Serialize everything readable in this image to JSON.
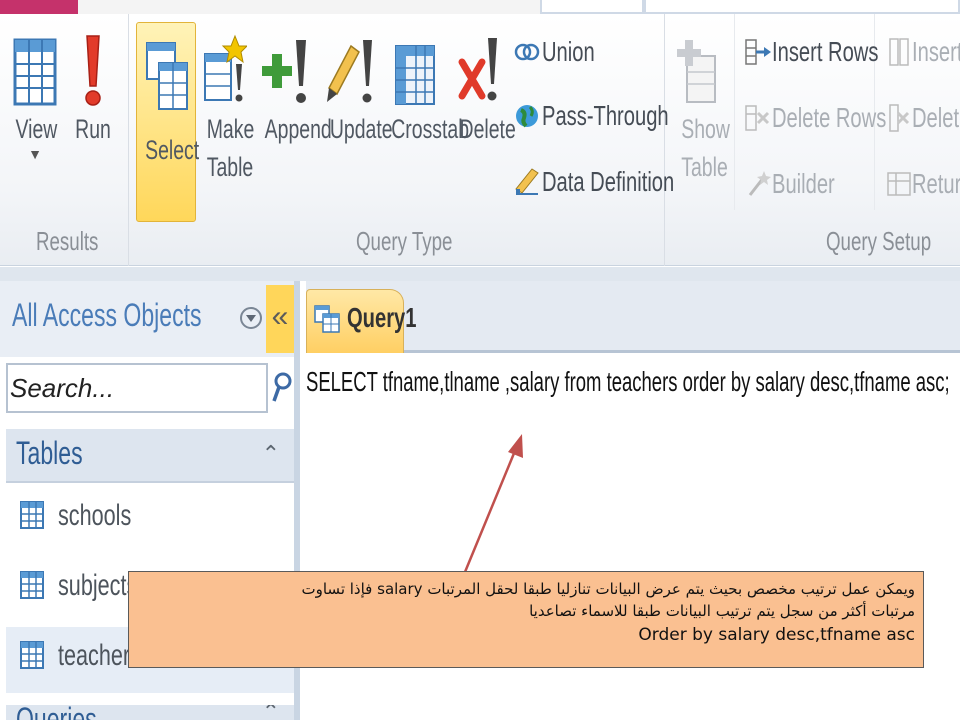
{
  "ribbon": {
    "groups": {
      "results": "Results",
      "query_type": "Query Type",
      "query_setup": "Query Setup"
    },
    "buttons": {
      "view": "View",
      "run": "Run",
      "select": "Select",
      "make_table_1": "Make",
      "make_table_2": "Table",
      "append": "Append",
      "update": "Update",
      "crosstab": "Crosstab",
      "delete": "Delete",
      "union": "Union",
      "pass_through": "Pass-Through",
      "data_definition": "Data Definition",
      "show_table_1": "Show",
      "show_table_2": "Table",
      "insert_rows": "Insert Rows",
      "delete_rows": "Delete Rows",
      "builder": "Builder",
      "insert_cols": "Insert",
      "delete_cols": "Delete",
      "return": "Return"
    }
  },
  "nav": {
    "title": "All Access Objects",
    "collapse_glyph": "«",
    "search_placeholder": "Search...",
    "section": "Tables",
    "section_chevron": "⌃",
    "items": [
      {
        "label": "schools"
      },
      {
        "label": "subjects"
      },
      {
        "label": "teachers"
      }
    ],
    "section2": "Queries"
  },
  "document": {
    "tab_label": "Query1",
    "sql": "SELECT tfname,tlname ,salary from teachers order by salary desc,tfname asc;"
  },
  "callout": {
    "line1": "ويمكن عمل ترتيب مخصص بحيث يتم عرض البيانات تنازليا طبقا لحقل المرتبات salary فإذا تساوت",
    "line2": "مرتبات أكثر من سجل يتم ترتيب البيانات طبقا للاسماء تصاعديا",
    "line3": "Order by salary desc,tfname asc"
  },
  "colors": {
    "callout_bg": "#fac091",
    "active_button": "#ffd75a",
    "nav_title": "#4a7cb8",
    "arrow": "#c0504d"
  }
}
